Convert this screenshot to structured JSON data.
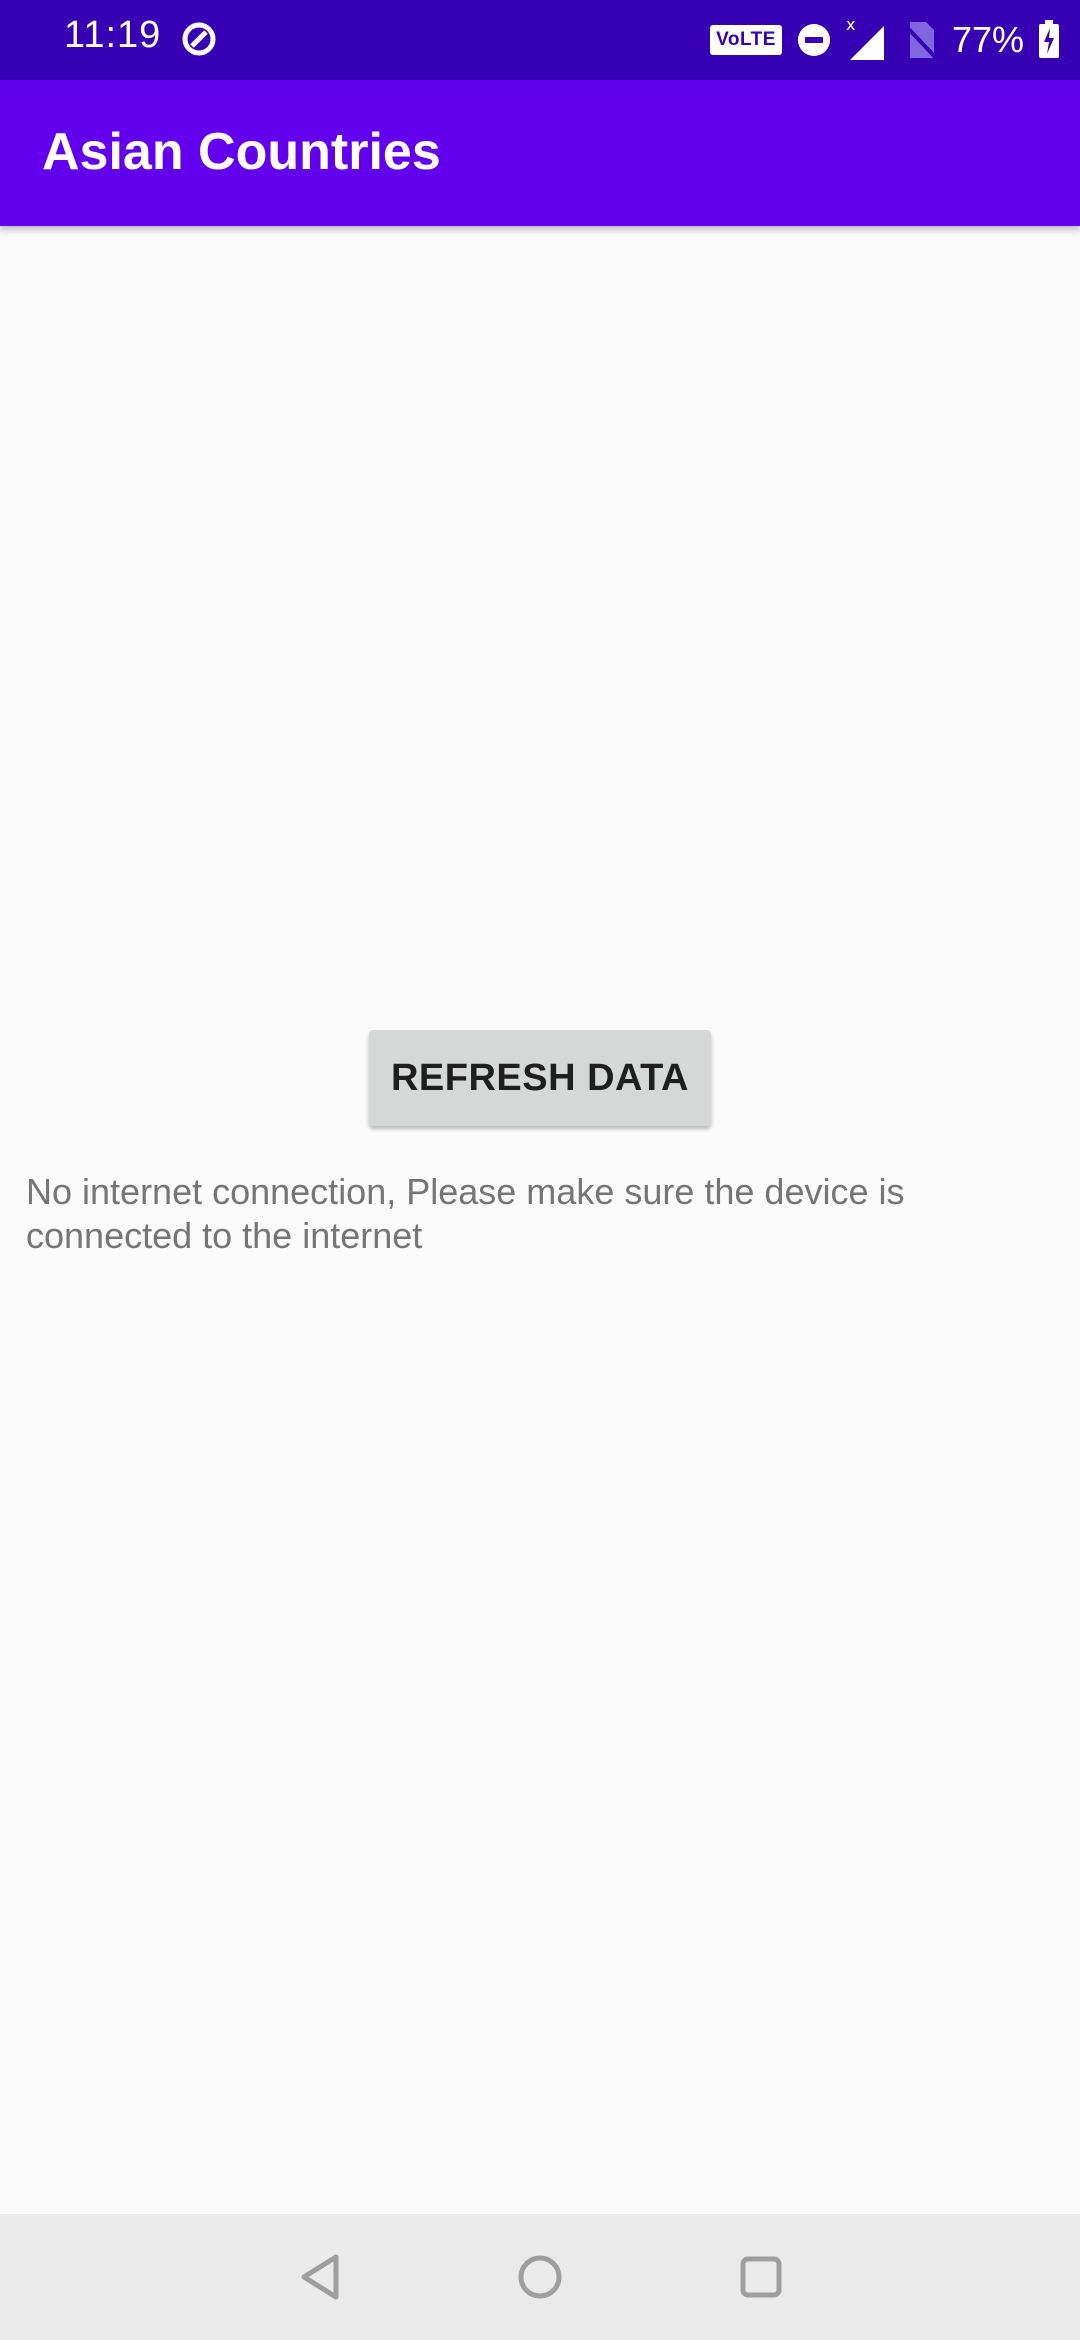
{
  "status_bar": {
    "time": "11:19",
    "left_icon": "do-not-disturb-icon",
    "volte": "VoLTE",
    "icons": [
      "dnd-minus-icon",
      "signal-x-icon",
      "no-sim-icon"
    ],
    "battery_percent": "77%",
    "battery_icon": "battery-charging-icon",
    "bg_color": "#3700b3"
  },
  "app_bar": {
    "title": "Asian Countries",
    "bg_color": "#6200ee"
  },
  "content": {
    "refresh_button_label": "REFRESH DATA",
    "message": "No internet connection, Please make sure the device is connected to the internet"
  },
  "nav_bar": {
    "buttons": [
      "back-icon",
      "home-icon",
      "recents-icon"
    ]
  }
}
